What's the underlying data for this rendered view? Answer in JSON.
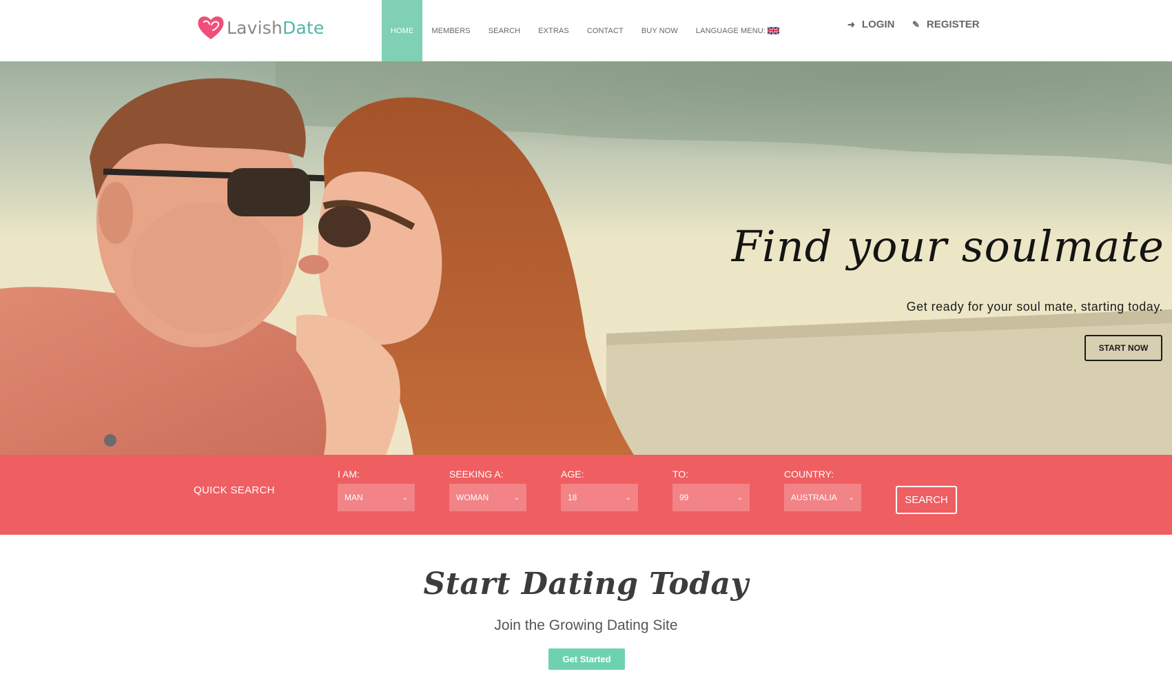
{
  "brand": {
    "name_part1": "Lavish",
    "name_part2": "Date"
  },
  "nav": {
    "items": [
      {
        "label": "HOME"
      },
      {
        "label": "MEMBERS"
      },
      {
        "label": "SEARCH"
      },
      {
        "label": "EXTRAS"
      },
      {
        "label": "CONTACT"
      },
      {
        "label": "BUY NOW"
      },
      {
        "label": "LANGUAGE MENU:"
      }
    ],
    "active": "HOME"
  },
  "auth": {
    "login_label": "LOGIN",
    "register_label": "REGISTER"
  },
  "hero": {
    "title": "Find your soulmate",
    "subtitle": "Get ready for your soul mate, starting today.",
    "cta_label": "START NOW"
  },
  "quick_search": {
    "title": "QUICK SEARCH",
    "fields": [
      {
        "label": "I AM:",
        "value": "MAN"
      },
      {
        "label": "SEEKING A:",
        "value": "WOMAN"
      },
      {
        "label": "AGE:",
        "value": "18"
      },
      {
        "label": "TO:",
        "value": "99"
      },
      {
        "label": "COUNTRY:",
        "value": "AUSTRALIA"
      }
    ],
    "button_label": "SEARCH"
  },
  "promo": {
    "title": "Start Dating Today",
    "subtitle": "Join the Growing Dating Site",
    "button_label": "Get Started"
  },
  "colors": {
    "accent_teal": "#7fd0b4",
    "quick_search_bg": "#ef5e61",
    "select_bg": "#f28387",
    "logo_pink": "#ef4f78"
  },
  "icons": {
    "login": "sign-in-icon",
    "register": "pencil-icon",
    "language_flag": "uk-flag-icon",
    "select_arrow": "chevron-down-icon"
  }
}
